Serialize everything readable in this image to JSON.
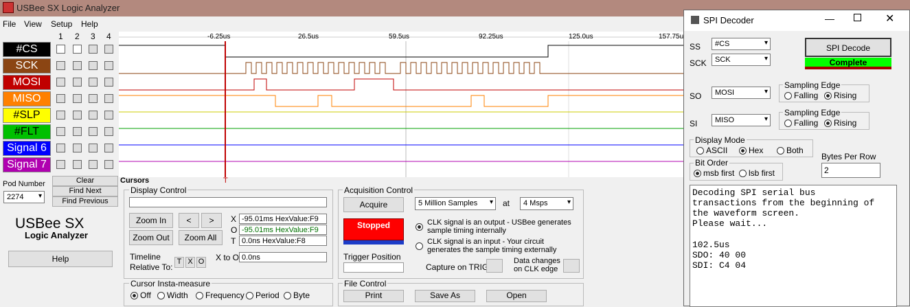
{
  "app": {
    "title": "USBee SX Logic Analyzer"
  },
  "menu": [
    "File",
    "View",
    "Setup",
    "Help"
  ],
  "columns": [
    "1",
    "2",
    "3",
    "4"
  ],
  "signals": [
    {
      "name": "#CS",
      "bg": "#000000",
      "fg": "#ffffff"
    },
    {
      "name": "SCK",
      "bg": "#8b4513",
      "fg": "#ffffff"
    },
    {
      "name": "MOSI",
      "bg": "#c00000",
      "fg": "#ffffff"
    },
    {
      "name": "MISO",
      "bg": "#ff8000",
      "fg": "#ffffff"
    },
    {
      "name": "#SLP",
      "bg": "#ffff00",
      "fg": "#000000"
    },
    {
      "name": "#FLT",
      "bg": "#00c000",
      "fg": "#000000"
    },
    {
      "name": "Signal 6",
      "bg": "#0000ff",
      "fg": "#ffffff"
    },
    {
      "name": "Signal 7",
      "bg": "#b000b0",
      "fg": "#ffffff"
    }
  ],
  "time_ticks": [
    "-6.25us",
    "26.5us",
    "59.5us",
    "92.25us",
    "125.0us",
    "157.75us"
  ],
  "left": {
    "clear": "Clear",
    "find_next": "Find Next",
    "find_prev": "Find Previous",
    "pod_label": "Pod Number",
    "pod_value": "2274",
    "brand1": "USBee SX",
    "brand2": "Logic Analyzer",
    "help": "Help"
  },
  "cursors": {
    "label": "Cursors",
    "trigger": "T"
  },
  "display": {
    "legend": "Display Control",
    "zoom_in": "Zoom In",
    "zoom_out": "Zoom Out",
    "zoom_all": "Zoom All",
    "prev": "<",
    "next": ">",
    "x_label": "X",
    "o_label": "O",
    "t_label": "T",
    "x_val": "-95.01ms HexValue:F9",
    "o_val": "-95.01ms HexValue:F9",
    "t_val": "0.0ns HexValue:F8",
    "timeline": "Timeline",
    "relative": "Relative To:",
    "rel_t": "T",
    "rel_x": "X",
    "rel_o": "O",
    "x_to_o": "X to O",
    "x_to_o_val": "0.0ns"
  },
  "insta": {
    "legend": "Cursor Insta-measure",
    "opts": [
      "Off",
      "Width",
      "Frequency",
      "Period",
      "Byte"
    ]
  },
  "acq": {
    "legend": "Acquisition Control",
    "acquire": "Acquire",
    "samples": "5 Million Samples",
    "at": "at",
    "rate": "4 Msps",
    "status": "Stopped",
    "clk_out": "CLK signal is an output - USBee generates sample timing internally",
    "clk_in": "CLK signal is an input - Your circuit generates the sample timing externally",
    "trigger_pos": "Trigger Position",
    "capture": "Capture on TRIG",
    "data_changes": "Data changes on CLK edge"
  },
  "file": {
    "legend": "File Control",
    "print": "Print",
    "save": "Save As",
    "open": "Open"
  },
  "spi": {
    "title": "SPI Decoder",
    "ss_label": "SS",
    "ss_val": "#CS",
    "sck_label": "SCK",
    "sck_val": "SCK",
    "decode": "SPI Decode",
    "complete": "Complete",
    "so_label": "SO",
    "so_val": "MOSI",
    "si_label": "SI",
    "si_val": "MISO",
    "edge_legend": "Sampling Edge",
    "falling": "Falling",
    "rising": "Rising",
    "display_mode": "Display Mode",
    "ascii": "ASCII",
    "hex": "Hex",
    "both": "Both",
    "bit_order": "Bit Order",
    "msb": "msb first",
    "lsb": "lsb first",
    "bytes_per_row": "Bytes Per Row",
    "bpr_val": "2",
    "output": [
      "Decoding SPI serial bus",
      "transactions from the beginning of",
      "the waveform screen.",
      "Please wait...",
      "",
      "102.5us",
      "SDO: 40 00",
      "SDI: C4 04"
    ]
  }
}
